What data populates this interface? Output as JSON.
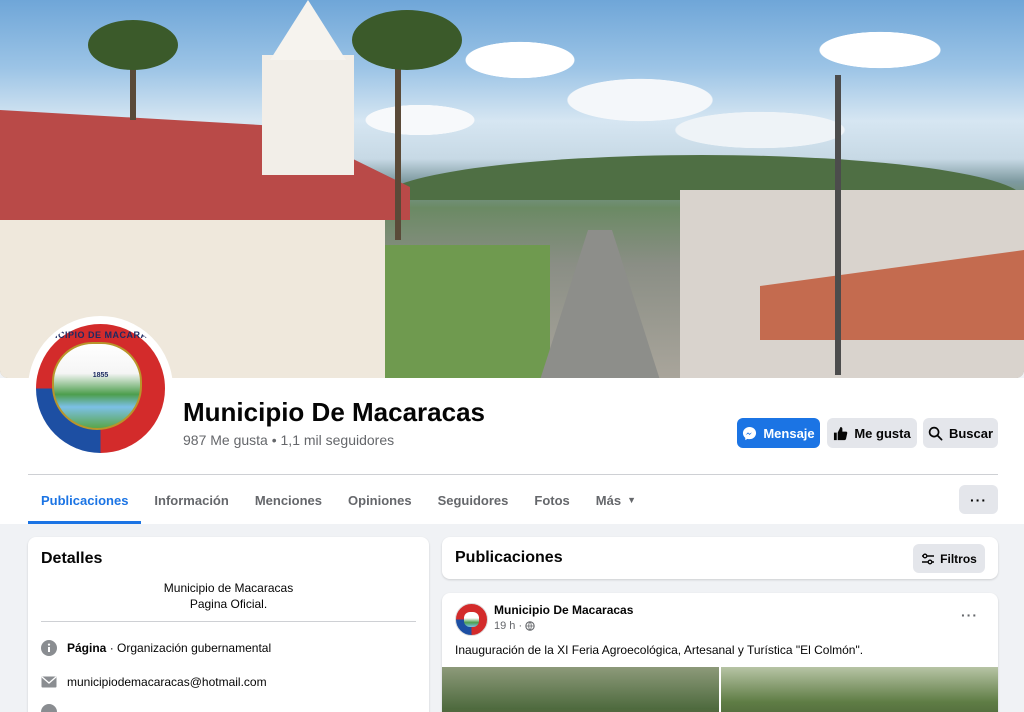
{
  "page": {
    "name": "Municipio De Macaracas",
    "stats": "987 Me gusta • 1,1 mil seguidores",
    "avatar_lettering": "MUNICIPIO DE MACARACAS",
    "avatar_year": "1855"
  },
  "actions": {
    "message": "Mensaje",
    "like": "Me gusta",
    "search": "Buscar",
    "more": "···"
  },
  "tabs": [
    {
      "label": "Publicaciones",
      "active": true
    },
    {
      "label": "Información"
    },
    {
      "label": "Menciones"
    },
    {
      "label": "Opiniones"
    },
    {
      "label": "Seguidores"
    },
    {
      "label": "Fotos"
    },
    {
      "label": "Más"
    }
  ],
  "details": {
    "title": "Detalles",
    "about_line1": "Municipio de Macaracas",
    "about_line2": "Pagina Oficial.",
    "category_label": "Página",
    "category_value": " · Organización gubernamental",
    "email": "municipiodemacaracas@hotmail.com"
  },
  "posts_header": {
    "title": "Publicaciones",
    "filters": "Filtros"
  },
  "post": {
    "author": "Municipio De Macaracas",
    "time": "19 h ·",
    "text": "Inauguración de la XI Feria Agroecológica, Artesanal y Turística \"El Colmón\".",
    "menu": "···"
  },
  "colors": {
    "accent": "#1b74e4",
    "background": "#f0f2f5",
    "secondary_button": "#e4e6eb"
  }
}
